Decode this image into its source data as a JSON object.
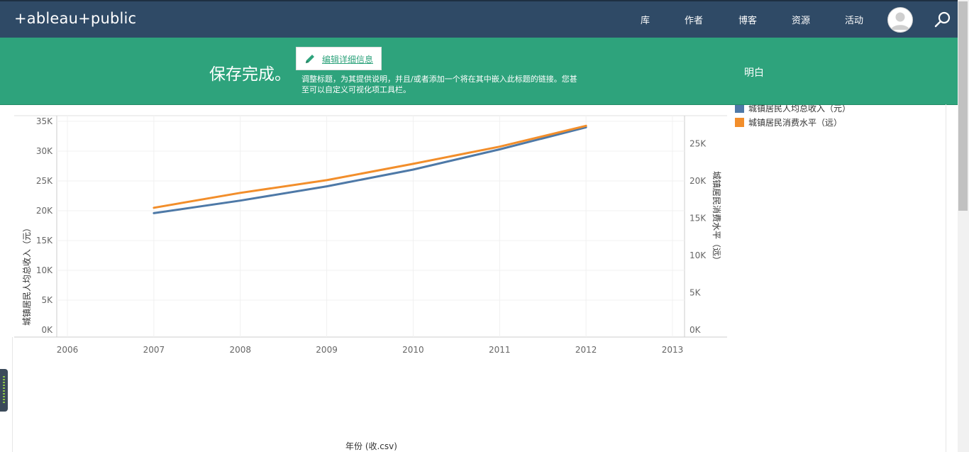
{
  "nav": {
    "logo": "+ableau+public",
    "items": [
      "库",
      "作者",
      "博客",
      "资源",
      "活动"
    ]
  },
  "banner": {
    "saved": "保存完成。",
    "edit_button": "编辑详细信息",
    "description": "调整标题，为其提供说明，并且/或者添加一个将在其中嵌入此标题的链接。您甚至可以自定义可视化项工具栏。",
    "got_it": "明白"
  },
  "chart_data": {
    "type": "line",
    "title": "",
    "x": [
      2007,
      2008,
      2009,
      2010,
      2011,
      2012
    ],
    "x_ticks": [
      "2006",
      "2007",
      "2008",
      "2009",
      "2010",
      "2011",
      "2012",
      "2013"
    ],
    "xlabel": "年份 (收.csv)",
    "y_left": {
      "label": "城镇居民人均总收入（元）",
      "ticks": [
        "0K",
        "5K",
        "10K",
        "15K",
        "20K",
        "25K",
        "30K",
        "35K"
      ],
      "range": [
        0,
        35000
      ]
    },
    "y_right": {
      "label": "城镇居民消费水平（远）",
      "ticks": [
        "0K",
        "5K",
        "10K",
        "15K",
        "20K",
        "25K"
      ],
      "range": [
        0,
        28000
      ]
    },
    "series": [
      {
        "name": "城镇居民人均总收入（元）",
        "axis": "left",
        "color": "#4e79a7",
        "values": [
          19600,
          21700,
          24100,
          26900,
          30300,
          34000
        ]
      },
      {
        "name": "城镇居民消费水平（远）",
        "axis": "right",
        "color": "#f28e2b",
        "values": [
          16400,
          18400,
          20100,
          22300,
          24600,
          27400
        ]
      }
    ]
  },
  "legend": [
    {
      "label": "城镇居民人均总收入（元）",
      "color": "#4e79a7"
    },
    {
      "label": "城镇居民消费水平（远）",
      "color": "#f28e2b"
    }
  ]
}
